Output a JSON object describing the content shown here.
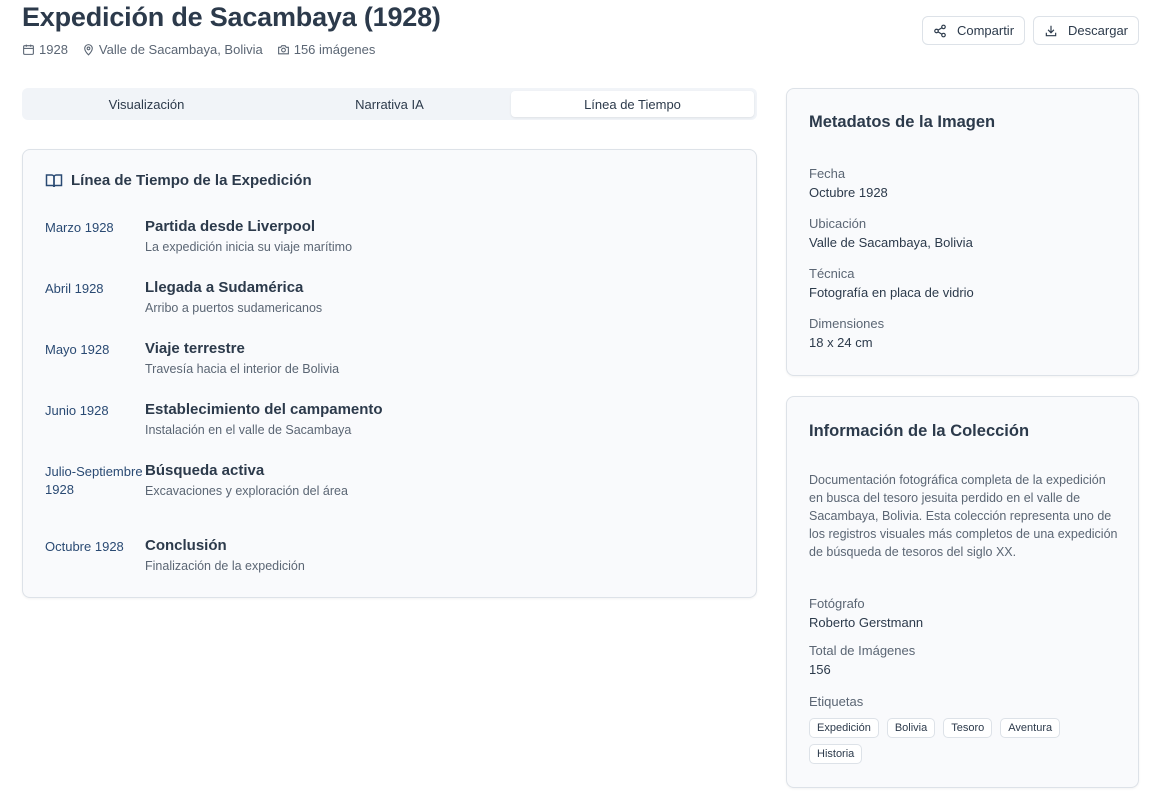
{
  "header": {
    "title": "Expedición de Sacambaya (1928)",
    "year": "1928",
    "location": "Valle de Sacambaya, Bolivia",
    "images": "156 imágenes",
    "share_label": "Compartir",
    "download_label": "Descargar"
  },
  "tabs": [
    {
      "label": "Visualización",
      "active": false
    },
    {
      "label": "Narrativa IA",
      "active": false
    },
    {
      "label": "Línea de Tiempo",
      "active": true
    }
  ],
  "timeline": {
    "title": "Línea de Tiempo de la Expedición",
    "events": [
      {
        "date": "Marzo 1928",
        "title": "Partida desde Liverpool",
        "desc": "La expedición inicia su viaje marítimo"
      },
      {
        "date": "Abril 1928",
        "title": "Llegada a Sudamérica",
        "desc": "Arribo a puertos sudamericanos"
      },
      {
        "date": "Mayo 1928",
        "title": "Viaje terrestre",
        "desc": "Travesía hacia el interior de Bolivia"
      },
      {
        "date": "Junio 1928",
        "title": "Establecimiento del campamento",
        "desc": "Instalación en el valle de Sacambaya"
      },
      {
        "date": "Julio-Septiembre 1928",
        "title": "Búsqueda activa",
        "desc": "Excavaciones y exploración del área"
      },
      {
        "date": "Octubre 1928",
        "title": "Conclusión",
        "desc": "Finalización de la expedición"
      }
    ]
  },
  "metadata": {
    "title": "Metadatos de la Imagen",
    "fields": [
      {
        "label": "Fecha",
        "value": "Octubre 1928"
      },
      {
        "label": "Ubicación",
        "value": "Valle de Sacambaya, Bolivia"
      },
      {
        "label": "Técnica",
        "value": "Fotografía en placa de vidrio"
      },
      {
        "label": "Dimensiones",
        "value": "18 x 24 cm"
      }
    ]
  },
  "collection": {
    "title": "Información de la Colección",
    "description": "Documentación fotográfica completa de la expedición en busca del tesoro jesuita perdido en el valle de Sacambaya, Bolivia. Esta colección representa uno de los registros visuales más completos de una expedición de búsqueda de tesoros del siglo XX.",
    "photographer_label": "Fotógrafo",
    "photographer": "Roberto Gerstmann",
    "total_label": "Total de Imágenes",
    "total": "156",
    "tags_label": "Etiquetas",
    "tags": [
      "Expedición",
      "Bolivia",
      "Tesoro",
      "Aventura",
      "Historia"
    ]
  }
}
